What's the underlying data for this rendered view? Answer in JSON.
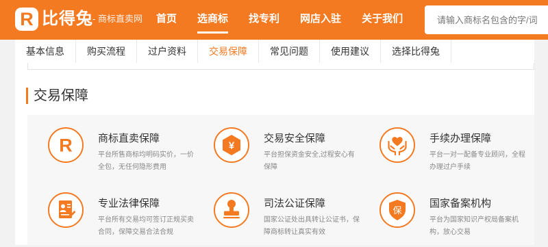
{
  "colors": {
    "brand": "#F47A22",
    "text": "#333333",
    "muted": "#888888",
    "panel": "#f7f7f7"
  },
  "header": {
    "logo": {
      "glyph": "R",
      "name": "比得兔",
      "tagline": "- 商标直卖网"
    },
    "nav": [
      {
        "label": "首页",
        "active": false
      },
      {
        "label": "选商标",
        "active": true
      },
      {
        "label": "找专利",
        "active": false
      },
      {
        "label": "网店入驻",
        "active": false
      },
      {
        "label": "关于我们",
        "active": false
      }
    ],
    "search": {
      "placeholder": "请输入商标名包含的字/词",
      "value": ""
    }
  },
  "tabs": {
    "items": [
      {
        "label": "基本信息",
        "active": false
      },
      {
        "label": "购买流程",
        "active": false
      },
      {
        "label": "过户资料",
        "active": false
      },
      {
        "label": "交易保障",
        "active": true
      },
      {
        "label": "常见问题",
        "active": false
      },
      {
        "label": "使用建议",
        "active": false
      },
      {
        "label": "选择比得兔",
        "active": false
      }
    ]
  },
  "section": {
    "title": "交易保障"
  },
  "guarantees": [
    {
      "icon": "r-letter-icon",
      "glyph": "R",
      "title": "商标直卖保障",
      "desc": "平台所售商标均明码实价，一价全包，无任何隐形费用"
    },
    {
      "icon": "yen-hexagon-icon",
      "glyph": "¥",
      "title": "交易安全保障",
      "desc": "平台担保资金安全,过程安心有保障"
    },
    {
      "icon": "hands-heart-icon",
      "title": "手续办理保障",
      "desc": "平台一对一配备专业顾问，全程办理过户手续"
    },
    {
      "icon": "contract-document-icon",
      "title": "专业法律保障",
      "desc": "平台所有交易均可签订正规买卖合同，保障交易合法合规"
    },
    {
      "icon": "stamp-icon",
      "title": "司法公证保障",
      "desc": "国家公证处出具转让公证书，保障商标转让真实有效"
    },
    {
      "icon": "shield-icon",
      "glyph": "保",
      "title": "国家备案机构",
      "desc": "平台为国家知识产权局备案机构，放心交易"
    }
  ]
}
